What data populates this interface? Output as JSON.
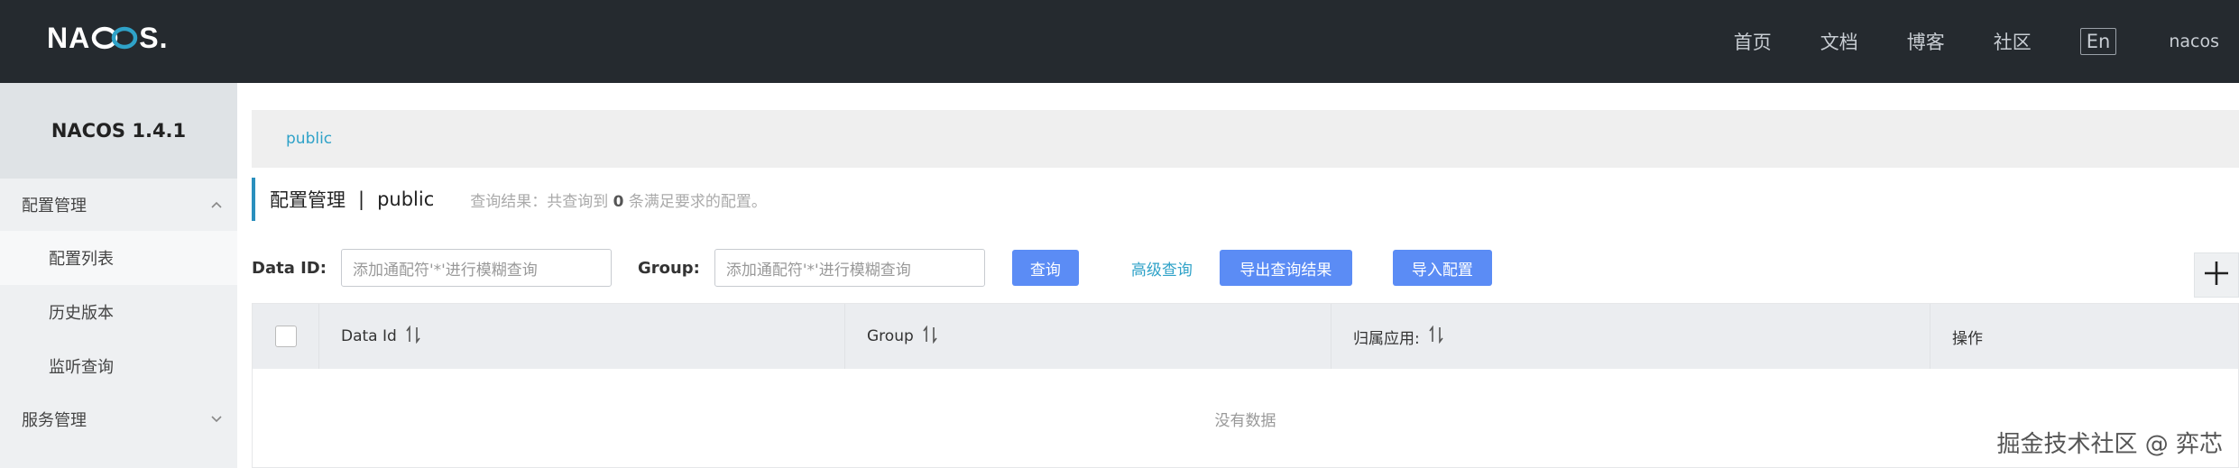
{
  "topbar": {
    "logo_left": "NA",
    "logo_right": "S",
    "logo_dot": ".",
    "nav": [
      "首页",
      "文档",
      "博客",
      "社区"
    ],
    "lang": "En",
    "user": "nacos"
  },
  "sidebar": {
    "brand": "NACOS 1.4.1",
    "groups": [
      {
        "label": "配置管理",
        "items": [
          "配置列表",
          "历史版本",
          "监听查询"
        ]
      },
      {
        "label": "服务管理"
      }
    ]
  },
  "main": {
    "namespace_tab": "public",
    "title": "配置管理",
    "title_sep": "|",
    "namespace": "public",
    "result_prefix": "查询结果：共查询到",
    "result_count": "0",
    "result_suffix": "条满足要求的配置。",
    "search": {
      "dataid_label": "Data ID:",
      "dataid_placeholder": "添加通配符'*'进行模糊查询",
      "group_label": "Group:",
      "group_placeholder": "添加通配符'*'进行模糊查询",
      "query_button": "查询",
      "advanced_link": "高级查询",
      "export_button": "导出查询结果",
      "import_button": "导入配置"
    },
    "table": {
      "columns": [
        "Data Id",
        "Group",
        "归属应用:",
        "操作"
      ],
      "empty_text": "没有数据"
    }
  },
  "watermark": "掘金技术社区 @ 弈芯",
  "colors": {
    "accent": "#2a8fbd",
    "primary_button": "#5b8cf5",
    "link": "#2fa2c8",
    "topbar": "#252a2f"
  }
}
